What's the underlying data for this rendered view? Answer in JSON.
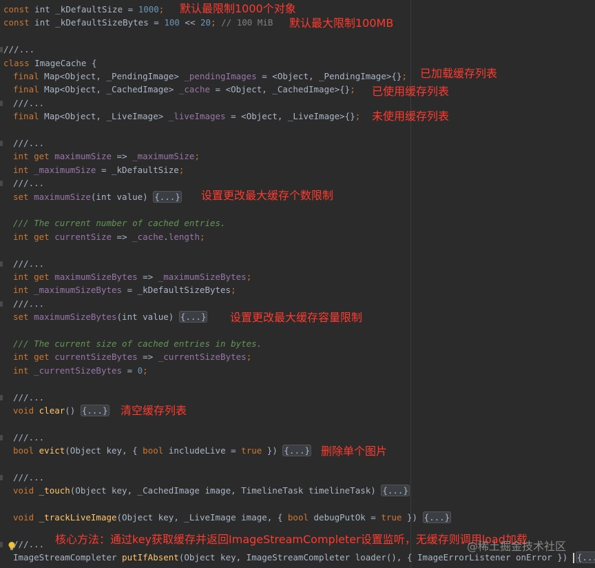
{
  "editor": {
    "lines": [
      {
        "tokens": [
          {
            "t": "const",
            "c": "kw"
          },
          {
            "t": " int _kDefaultSize = ",
            "c": "plain"
          },
          {
            "t": "1000",
            "c": "num"
          },
          {
            "t": ";",
            "c": "kw"
          }
        ]
      },
      {
        "tokens": [
          {
            "t": "const",
            "c": "kw"
          },
          {
            "t": " int _kDefaultSizeBytes = ",
            "c": "plain"
          },
          {
            "t": "100",
            "c": "num"
          },
          {
            "t": " << ",
            "c": "plain"
          },
          {
            "t": "20",
            "c": "num"
          },
          {
            "t": "; ",
            "c": "kw"
          },
          {
            "t": "// 100 MiB",
            "c": "cm"
          }
        ]
      },
      {
        "tokens": []
      },
      {
        "tokens": [
          {
            "t": "///...",
            "c": "plain"
          }
        ],
        "fold": true
      },
      {
        "tokens": [
          {
            "t": "class",
            "c": "kw"
          },
          {
            "t": " ImageCache {",
            "c": "plain"
          }
        ]
      },
      {
        "indent": 1,
        "tokens": [
          {
            "t": "final",
            "c": "kw"
          },
          {
            "t": " Map<Object, _PendingImage> ",
            "c": "plain"
          },
          {
            "t": "_pendingImages",
            "c": "fld"
          },
          {
            "t": " = <Object, _PendingImage>{}",
            "c": "plain"
          },
          {
            "t": ";",
            "c": "kw"
          }
        ]
      },
      {
        "indent": 1,
        "tokens": [
          {
            "t": "final",
            "c": "kw"
          },
          {
            "t": " Map<Object, _CachedImage> ",
            "c": "plain"
          },
          {
            "t": "_cache",
            "c": "fld"
          },
          {
            "t": " = <Object, _CachedImage>{}",
            "c": "plain"
          },
          {
            "t": ";",
            "c": "kw"
          }
        ]
      },
      {
        "indent": 1,
        "tokens": [
          {
            "t": "///...",
            "c": "plain"
          }
        ],
        "fold": true
      },
      {
        "indent": 1,
        "tokens": [
          {
            "t": "final",
            "c": "kw"
          },
          {
            "t": " Map<Object, _LiveImage> ",
            "c": "plain"
          },
          {
            "t": "_liveImages",
            "c": "fld"
          },
          {
            "t": " = <Object, _LiveImage>{}",
            "c": "plain"
          },
          {
            "t": ";",
            "c": "kw"
          }
        ]
      },
      {
        "tokens": []
      },
      {
        "indent": 1,
        "tokens": [
          {
            "t": "///...",
            "c": "plain"
          }
        ],
        "fold": true
      },
      {
        "indent": 1,
        "tokens": [
          {
            "t": "int",
            "c": "kw"
          },
          {
            "t": " ",
            "c": "plain"
          },
          {
            "t": "get",
            "c": "kw"
          },
          {
            "t": " ",
            "c": "plain"
          },
          {
            "t": "maximumSize",
            "c": "fld"
          },
          {
            "t": " => ",
            "c": "plain"
          },
          {
            "t": "_maximumSize",
            "c": "fld"
          },
          {
            "t": ";",
            "c": "kw"
          }
        ]
      },
      {
        "indent": 1,
        "tokens": [
          {
            "t": "int",
            "c": "kw"
          },
          {
            "t": " ",
            "c": "plain"
          },
          {
            "t": "_maximumSize",
            "c": "fld"
          },
          {
            "t": " = _kDefaultSize",
            "c": "plain"
          },
          {
            "t": ";",
            "c": "kw"
          }
        ]
      },
      {
        "indent": 1,
        "tokens": [
          {
            "t": "///...",
            "c": "plain"
          }
        ],
        "fold": true
      },
      {
        "indent": 1,
        "tokens": [
          {
            "t": "set",
            "c": "kw"
          },
          {
            "t": " ",
            "c": "plain"
          },
          {
            "t": "maximumSize",
            "c": "fld"
          },
          {
            "t": "(int value) ",
            "c": "plain"
          },
          {
            "t": "{...}",
            "c": "folded"
          }
        ]
      },
      {
        "tokens": []
      },
      {
        "indent": 1,
        "tokens": [
          {
            "t": "/// The current number of cached entries.",
            "c": "doc"
          }
        ]
      },
      {
        "indent": 1,
        "tokens": [
          {
            "t": "int",
            "c": "kw"
          },
          {
            "t": " ",
            "c": "plain"
          },
          {
            "t": "get",
            "c": "kw"
          },
          {
            "t": " ",
            "c": "plain"
          },
          {
            "t": "currentSize",
            "c": "fld"
          },
          {
            "t": " => ",
            "c": "plain"
          },
          {
            "t": "_cache",
            "c": "fld"
          },
          {
            "t": ".",
            "c": "plain"
          },
          {
            "t": "length",
            "c": "fld"
          },
          {
            "t": ";",
            "c": "kw"
          }
        ]
      },
      {
        "tokens": []
      },
      {
        "indent": 1,
        "tokens": [
          {
            "t": "///...",
            "c": "plain"
          }
        ],
        "fold": true
      },
      {
        "indent": 1,
        "tokens": [
          {
            "t": "int",
            "c": "kw"
          },
          {
            "t": " ",
            "c": "plain"
          },
          {
            "t": "get",
            "c": "kw"
          },
          {
            "t": " ",
            "c": "plain"
          },
          {
            "t": "maximumSizeBytes",
            "c": "fld"
          },
          {
            "t": " => ",
            "c": "plain"
          },
          {
            "t": "_maximumSizeBytes",
            "c": "fld"
          },
          {
            "t": ";",
            "c": "kw"
          }
        ]
      },
      {
        "indent": 1,
        "tokens": [
          {
            "t": "int",
            "c": "kw"
          },
          {
            "t": " ",
            "c": "plain"
          },
          {
            "t": "_maximumSizeBytes",
            "c": "fld"
          },
          {
            "t": " = _kDefaultSizeBytes",
            "c": "plain"
          },
          {
            "t": ";",
            "c": "kw"
          }
        ]
      },
      {
        "indent": 1,
        "tokens": [
          {
            "t": "///...",
            "c": "plain"
          }
        ],
        "fold": true
      },
      {
        "indent": 1,
        "tokens": [
          {
            "t": "set",
            "c": "kw"
          },
          {
            "t": " ",
            "c": "plain"
          },
          {
            "t": "maximumSizeBytes",
            "c": "fld"
          },
          {
            "t": "(int value) ",
            "c": "plain"
          },
          {
            "t": "{...}",
            "c": "folded"
          }
        ]
      },
      {
        "tokens": []
      },
      {
        "indent": 1,
        "tokens": [
          {
            "t": "/// The current size of cached entries in bytes.",
            "c": "doc"
          }
        ]
      },
      {
        "indent": 1,
        "tokens": [
          {
            "t": "int",
            "c": "kw"
          },
          {
            "t": " ",
            "c": "plain"
          },
          {
            "t": "get",
            "c": "kw"
          },
          {
            "t": " ",
            "c": "plain"
          },
          {
            "t": "currentSizeBytes",
            "c": "fld"
          },
          {
            "t": " => ",
            "c": "plain"
          },
          {
            "t": "_currentSizeBytes",
            "c": "fld"
          },
          {
            "t": ";",
            "c": "kw"
          }
        ]
      },
      {
        "indent": 1,
        "tokens": [
          {
            "t": "int",
            "c": "kw"
          },
          {
            "t": " ",
            "c": "plain"
          },
          {
            "t": "_currentSizeBytes",
            "c": "fld"
          },
          {
            "t": " = ",
            "c": "plain"
          },
          {
            "t": "0",
            "c": "num"
          },
          {
            "t": ";",
            "c": "kw"
          }
        ]
      },
      {
        "tokens": []
      },
      {
        "indent": 1,
        "tokens": [
          {
            "t": "///...",
            "c": "plain"
          }
        ],
        "fold": true
      },
      {
        "indent": 1,
        "tokens": [
          {
            "t": "void",
            "c": "kw"
          },
          {
            "t": " ",
            "c": "plain"
          },
          {
            "t": "clear",
            "c": "fn"
          },
          {
            "t": "() ",
            "c": "plain"
          },
          {
            "t": "{...}",
            "c": "folded"
          }
        ]
      },
      {
        "tokens": []
      },
      {
        "indent": 1,
        "tokens": [
          {
            "t": "///...",
            "c": "plain"
          }
        ],
        "fold": true
      },
      {
        "indent": 1,
        "tokens": [
          {
            "t": "bool",
            "c": "kw"
          },
          {
            "t": " ",
            "c": "plain"
          },
          {
            "t": "evict",
            "c": "fn"
          },
          {
            "t": "(Object key, { ",
            "c": "plain"
          },
          {
            "t": "bool",
            "c": "kw"
          },
          {
            "t": " includeLive = ",
            "c": "plain"
          },
          {
            "t": "true",
            "c": "kw"
          },
          {
            "t": " }) ",
            "c": "plain"
          },
          {
            "t": "{...}",
            "c": "folded"
          }
        ]
      },
      {
        "tokens": []
      },
      {
        "indent": 1,
        "tokens": [
          {
            "t": "///...",
            "c": "plain"
          }
        ],
        "fold": true
      },
      {
        "indent": 1,
        "tokens": [
          {
            "t": "void",
            "c": "kw"
          },
          {
            "t": " ",
            "c": "plain"
          },
          {
            "t": "_touch",
            "c": "fn"
          },
          {
            "t": "(Object key, _CachedImage image, TimelineTask timelineTask) ",
            "c": "plain"
          },
          {
            "t": "{...}",
            "c": "folded"
          }
        ]
      },
      {
        "tokens": []
      },
      {
        "indent": 1,
        "tokens": [
          {
            "t": "void",
            "c": "kw"
          },
          {
            "t": " ",
            "c": "plain"
          },
          {
            "t": "_trackLiveImage",
            "c": "fn"
          },
          {
            "t": "(Object key, _LiveImage image, { ",
            "c": "plain"
          },
          {
            "t": "bool",
            "c": "kw"
          },
          {
            "t": " debugPutOk = ",
            "c": "plain"
          },
          {
            "t": "true",
            "c": "kw"
          },
          {
            "t": " }) ",
            "c": "plain"
          },
          {
            "t": "{...}",
            "c": "folded"
          }
        ]
      },
      {
        "tokens": []
      },
      {
        "indent": 1,
        "tokens": [
          {
            "t": "///...",
            "c": "plain"
          }
        ],
        "fold": true,
        "bulb": true
      },
      {
        "indent": 1,
        "tokens": [
          {
            "t": "ImageStreamCompleter ",
            "c": "plain"
          },
          {
            "t": "putIfAbsent",
            "c": "fn"
          },
          {
            "t": "(Object key, ImageStreamCompleter loader(), { ImageErrorListener onError }) ",
            "c": "plain"
          },
          {
            "t": "caret",
            "c": "caret"
          },
          {
            "t": "{...}",
            "c": "folded"
          }
        ]
      }
    ]
  },
  "annotations": {
    "default_size": "默认最限制1000个对象",
    "default_bytes": "默认最大限制100MB",
    "pending": "已加载缓存列表",
    "cache": "已使用缓存列表",
    "live": "未使用缓存列表",
    "set_max_size": "设置更改最大缓存个数限制",
    "set_max_bytes": "设置更改最大缓存容量限制",
    "clear": "清空缓存列表",
    "evict": "删除单个图片",
    "put_if_absent": "核心方法：通过key获取缓存并返回ImageStreamCompleter设置监听，无缓存则调用load加载"
  },
  "watermark": "@稀土掘金技术社区",
  "icons": {
    "intention": "lightbulb-icon"
  }
}
